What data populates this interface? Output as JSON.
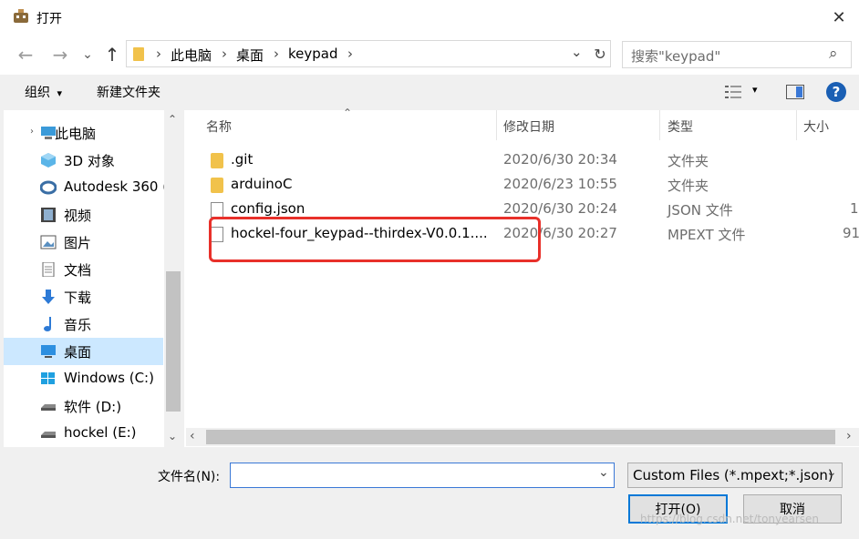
{
  "window": {
    "title": "打开",
    "close_glyph": "✕"
  },
  "nav": {
    "back_glyph": "←",
    "forward_glyph": "→",
    "recent_glyph": "⌄",
    "up_glyph": "↑",
    "breadcrumb": [
      "此电脑",
      "桌面",
      "keypad"
    ],
    "sep_glyph": "›",
    "dropdown_glyph": "⌄",
    "refresh_glyph": "↻",
    "search_placeholder": "搜索\"keypad\"",
    "search_glyph": "⌕"
  },
  "toolbar": {
    "organize": "组织",
    "organize_caret": "▾",
    "new_folder": "新建文件夹",
    "view_caret": "▾",
    "help": "?"
  },
  "sidebar": {
    "scroll_up": "⌃",
    "scroll_down": "⌄",
    "items": [
      {
        "label": "此电脑",
        "icon": "computer-icon"
      },
      {
        "label": "3D 对象",
        "icon": "3d-objects-icon"
      },
      {
        "label": "Autodesk 360 (",
        "icon": "autodesk-360-icon"
      },
      {
        "label": "视频",
        "icon": "video-icon"
      },
      {
        "label": "图片",
        "icon": "pictures-icon"
      },
      {
        "label": "文档",
        "icon": "documents-icon"
      },
      {
        "label": "下载",
        "icon": "download-icon"
      },
      {
        "label": "音乐",
        "icon": "music-icon"
      },
      {
        "label": "桌面",
        "icon": "desktop-icon",
        "selected": true
      },
      {
        "label": "Windows (C:)",
        "icon": "windows-drive-icon"
      },
      {
        "label": "软件 (D:)",
        "icon": "drive-icon"
      },
      {
        "label": "hockel (E:)",
        "icon": "drive-icon"
      }
    ]
  },
  "columns": {
    "name": "名称",
    "date": "修改日期",
    "type": "类型",
    "size": "大小",
    "sort_glyph": "⌃"
  },
  "files": [
    {
      "name": ".git",
      "date": "2020/6/30 20:34",
      "type": "文件夹",
      "size": "",
      "kind": "folder"
    },
    {
      "name": "arduinoC",
      "date": "2020/6/23 10:55",
      "type": "文件夹",
      "size": "",
      "kind": "folder"
    },
    {
      "name": "config.json",
      "date": "2020/6/30 20:24",
      "type": "JSON 文件",
      "size": "1",
      "kind": "file"
    },
    {
      "name": "hockel-four_keypad--thirdex-V0.0.1....",
      "date": "2020/6/30 20:27",
      "type": "MPEXT 文件",
      "size": "91",
      "kind": "file"
    }
  ],
  "hscroll": {
    "left_glyph": "‹",
    "right_glyph": "›"
  },
  "bottom": {
    "filename_label": "文件名(N):",
    "filename_value": "",
    "filename_dropdown": "⌄",
    "filter_value": "Custom Files (*.mpext;*.json)",
    "filter_dropdown": "⌄",
    "open_button": "打开(O)",
    "cancel_button": "取消"
  },
  "watermark": "https://blog.csdn.net/tonyearsen",
  "colors": {
    "highlight": "#e8302a",
    "selected": "#cce8ff",
    "folder": "#f1c24b",
    "accent": "#0078d7"
  }
}
